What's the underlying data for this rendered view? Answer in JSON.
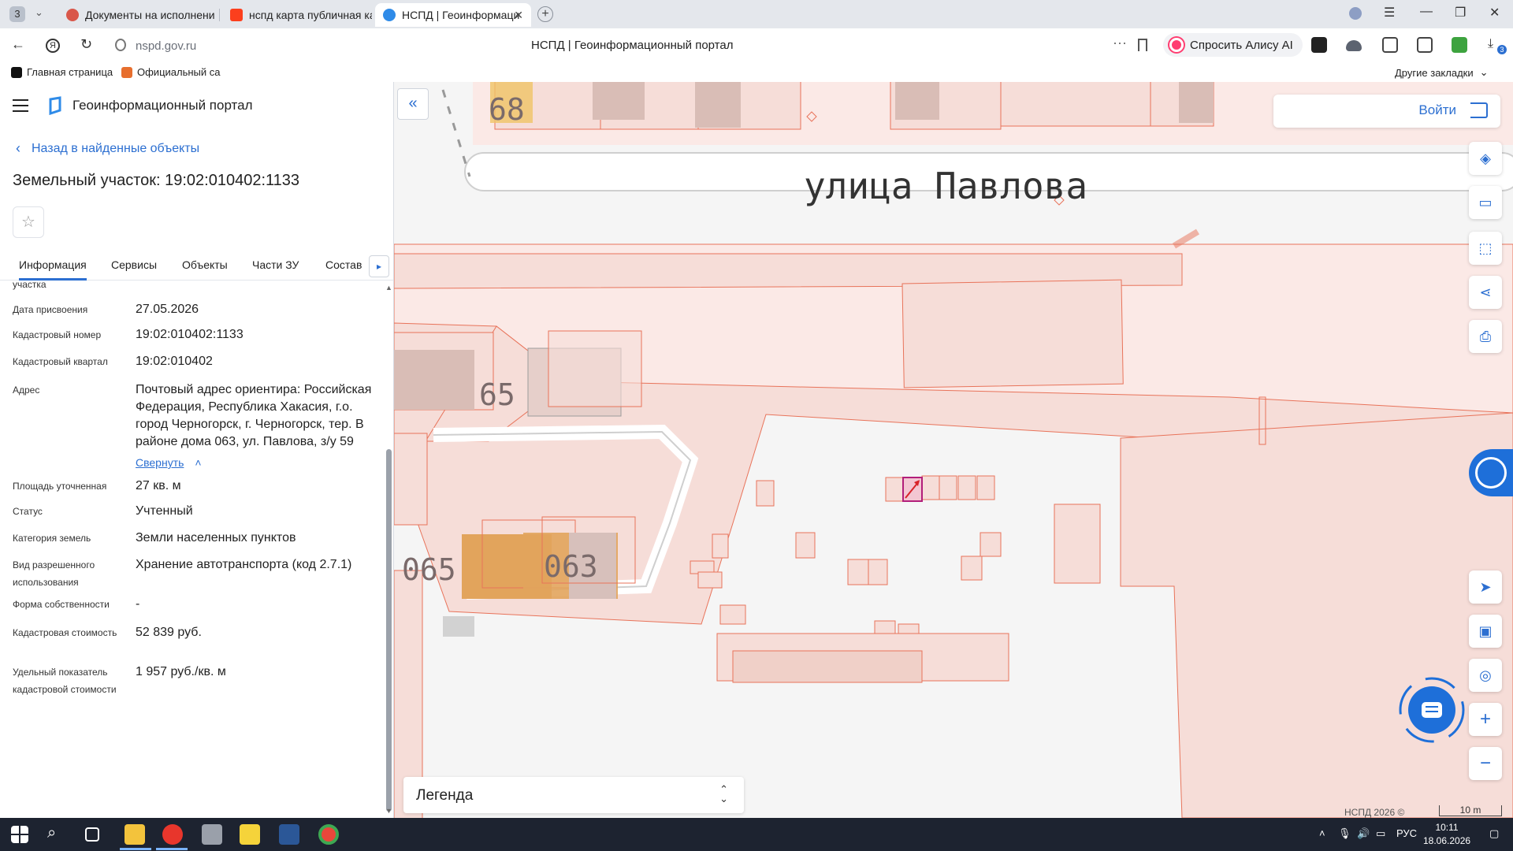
{
  "browser": {
    "tab_count": "3",
    "tabs": [
      {
        "label": "Документы на исполнени"
      },
      {
        "label": "нспд карта публичная ка"
      },
      {
        "label": "НСПД | Геоинформаци"
      }
    ],
    "url_host": "nspd.gov.ru",
    "page_title": "НСПД | Геоинформационный портал",
    "alice_label": "Спросить Алису AI",
    "bookmarks": [
      {
        "label": "Главная страница"
      },
      {
        "label": "Официальный са"
      }
    ],
    "other_bookmarks": "Другие закладки",
    "ext_badge": "3"
  },
  "panel": {
    "portal_title": "Геоинформационный портал",
    "back_link": "Назад в найденные объекты",
    "object_title": "Земельный участок: 19:02:010402:1133",
    "tabs": [
      {
        "label": "Информация"
      },
      {
        "label": "Сервисы"
      },
      {
        "label": "Объекты"
      },
      {
        "label": "Части ЗУ"
      },
      {
        "label": "Состав"
      }
    ],
    "clipped_label": "участка",
    "properties": [
      {
        "label": "Дата присвоения",
        "value": "27.05.2026"
      },
      {
        "label": "Кадастровый номер",
        "value": "19:02:010402:1133"
      },
      {
        "label": "Кадастровый квартал",
        "value": "19:02:010402"
      },
      {
        "label": "Адрес",
        "value": "Почтовый адрес ориентира: Российская Федерация, Республика Хакасия, г.о. город Черногорск, г. Черногорск, тер. В районе дома 063, ул. Павлова, з/у 59"
      },
      {
        "label": "Площадь уточненная",
        "value": "27 кв. м"
      },
      {
        "label": "Статус",
        "value": "Учтенный"
      },
      {
        "label": "Категория земель",
        "value": "Земли населенных пунктов"
      },
      {
        "label": "Вид разрешенного использования",
        "value": "Хранение автотранспорта (код 2.7.1)"
      },
      {
        "label": "Форма собственности",
        "value": "-"
      },
      {
        "label": "Кадастровая стоимость",
        "value": "52 839 руб."
      },
      {
        "label": "Удельный показатель кадастровой стоимости",
        "value": "1 957 руб./кв. м"
      }
    ],
    "collapse_link": "Свернуть"
  },
  "map": {
    "street_label": "улица Павлова",
    "house_labels": [
      "68",
      "65",
      "065",
      "063"
    ],
    "login_label": "Войти",
    "legend_label": "Легенда",
    "copyright": "НСПД 2026 ©",
    "scale_label": "10 m"
  },
  "taskbar": {
    "lang": "РУС",
    "time": "10:11",
    "date": "18.06.2026"
  },
  "colors": {
    "accent": "#2c6fd1",
    "parcel_fill": "#f6ddd8",
    "parcel_stroke": "#e8735a",
    "selected_parcel": "#b21e7a"
  }
}
